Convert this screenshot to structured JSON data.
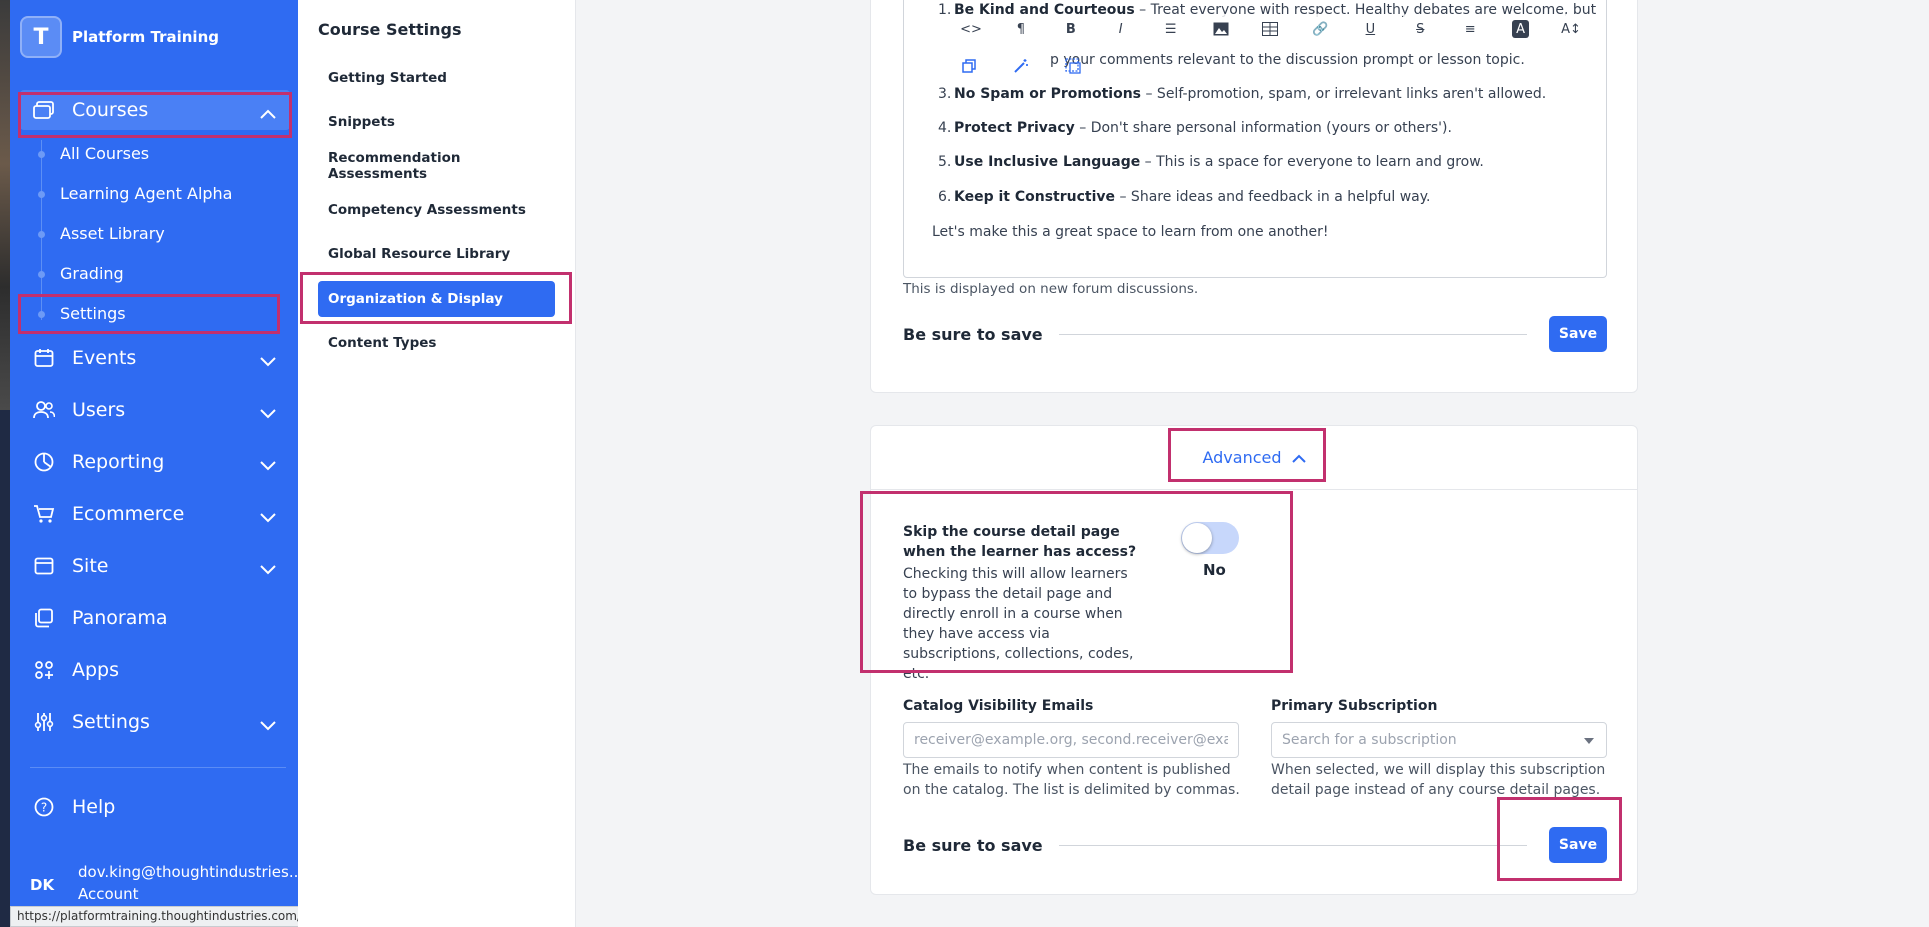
{
  "brand": {
    "logo_letter": "T",
    "name": "Platform Training"
  },
  "nav": {
    "courses": "Courses",
    "courses_sub": [
      "All Courses",
      "Learning Agent Alpha",
      "Asset Library",
      "Grading",
      "Settings"
    ],
    "events": "Events",
    "users": "Users",
    "reporting": "Reporting",
    "ecommerce": "Ecommerce",
    "site": "Site",
    "panorama": "Panorama",
    "apps": "Apps",
    "settings": "Settings",
    "help": "Help"
  },
  "account": {
    "initials": "DK",
    "email": "dov.king@thoughtindustries...",
    "label": "Account"
  },
  "status_url": "https://platformtraining.thoughtindustries.com/learn/manager",
  "course_settings": {
    "heading": "Course Settings",
    "items": [
      "Getting Started",
      "Snippets",
      "Recommendation Assessments",
      "Competency Assessments",
      "Global Resource Library",
      "Organization & Display",
      "Content Types"
    ],
    "active_index": 5
  },
  "editor": {
    "toolbar_row1": [
      "<>",
      "¶",
      "B",
      "I",
      "☰",
      "🖼",
      "▦",
      "🔗",
      "U",
      "S",
      "≡",
      "A",
      "A↕"
    ],
    "rules": [
      {
        "num": "1.",
        "title": "Be Kind and Courteous",
        "text": " – Treat everyone with respect. Healthy debates are welcome, but"
      },
      {
        "num": "",
        "title": "",
        "text": "p your comments relevant to the discussion prompt or lesson topic."
      },
      {
        "num": "3.",
        "title": "No Spam or Promotions",
        "text": " – Self-promotion, spam, or irrelevant links aren't allowed."
      },
      {
        "num": "4.",
        "title": "Protect Privacy",
        "text": " – Don't share personal information (yours or others')."
      },
      {
        "num": "5.",
        "title": "Use Inclusive Language",
        "text": " – This is a space for everyone to learn and grow."
      },
      {
        "num": "6.",
        "title": "Keep it Constructive",
        "text": " – Share ideas and feedback in a helpful way."
      }
    ],
    "closing": "Let's make this a great space to learn from one another!",
    "help": "This is displayed on new forum discussions."
  },
  "save": {
    "label": "Be sure to save",
    "button": "Save"
  },
  "advanced": {
    "toggle_label": "Advanced",
    "skip_title": "Skip the course detail page when the learner has access?",
    "skip_desc": "Checking this will allow learners to bypass the detail page and directly enroll in a course when they have access via subscriptions, collections, codes, etc.",
    "switch_value": "No",
    "catalog_label": "Catalog Visibility Emails",
    "catalog_placeholder": "receiver@example.org, second.receiver@example.org",
    "catalog_help": "The emails to notify when content is published on the catalog. The list is delimited by commas.",
    "subscription_label": "Primary Subscription",
    "subscription_placeholder": "Search for a subscription",
    "subscription_help": "When selected, we will display this subscription detail page instead of any course detail pages."
  },
  "colors": {
    "primary": "#2f6bf2",
    "highlight": "#c2306e"
  }
}
